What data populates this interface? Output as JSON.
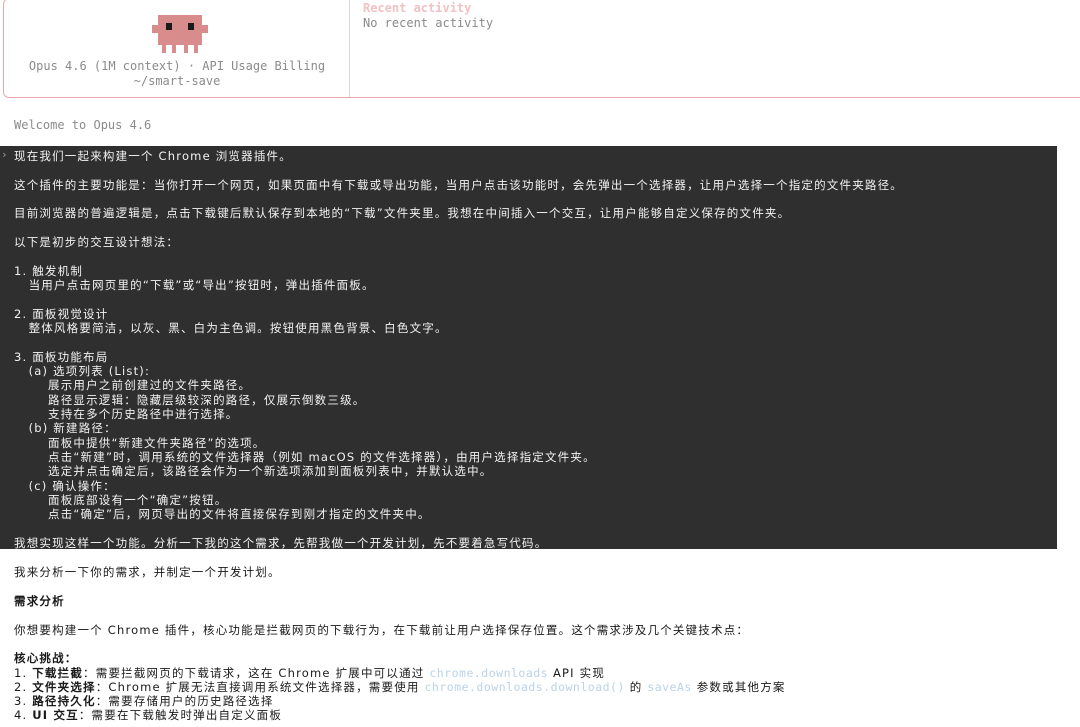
{
  "header": {
    "model_info": "Opus 4.6 (1M context) · API Usage Billing",
    "directory": "~/smart-save",
    "recent_title": "Recent activity",
    "recent_empty": "No recent activity",
    "mascot_color": "#d98c8c"
  },
  "welcome": "Welcome to Opus 4.6",
  "prompt": {
    "caret": "›",
    "lines": [
      "现在我们一起来构建一个 Chrome 浏览器插件。",
      "这个插件的主要功能是：当你打开一个网页，如果页面中有下载或导出功能，当用户点击该功能时，会先弹出一个选择器，让用户选择一个指定的文件夹路径。",
      "目前浏览器的普遍逻辑是，点击下载键后默认保存到本地的“下载”文件夹里。我想在中间插入一个交互，让用户能够自定义保存的文件夹。",
      "以下是初步的交互设计想法：",
      "1. 触发机制",
      "   当用户点击网页里的“下载”或“导出”按钮时，弹出插件面板。",
      "2. 面板视觉设计",
      "   整体风格要简洁，以灰、黑、白为主色调。按钮使用黑色背景、白色文字。",
      "3. 面板功能布局",
      "   (a) 选项列表 (List):",
      "       展示用户之前创建过的文件夹路径。",
      "       路径显示逻辑：隐藏层级较深的路径，仅展示倒数三级。",
      "       支持在多个历史路径中进行选择。",
      "   (b) 新建路径：",
      "       面板中提供“新建文件夹路径”的选项。",
      "       点击“新建”时，调用系统的文件选择器（例如 macOS 的文件选择器），由用户选择指定文件夹。",
      "       选定并点击确定后，该路径会作为一个新选项添加到面板列表中，并默认选中。",
      "   (c) 确认操作：",
      "       面板底部设有一个“确定”按钮。",
      "       点击“确定”后，网页导出的文件将直接保存到刚才指定的文件夹中。",
      "我想实现这样一个功能。分析一下我的这个需求，先帮我做一个开发计划，先不要着急写代码。"
    ]
  },
  "response": {
    "intro": "我来分析一下你的需求，并制定一个开发计划。",
    "section_title": "需求分析",
    "summary": "你想要构建一个 Chrome 插件，核心功能是拦截网页的下载行为，在下载前让用户选择保存位置。这个需求涉及几个关键技术点：",
    "challenges_title": "核心挑战：",
    "item1_num": "1. ",
    "item1_bold": "下载拦截",
    "item1_text": "：需要拦截网页的下载请求，这在 Chrome 扩展中可以通过 ",
    "item1_code": "chrome.downloads",
    "item1_tail": " API 实现",
    "item2_num": "2. ",
    "item2_bold": "文件夹选择",
    "item2_text": "：Chrome 扩展无法直接调用系统文件选择器，需要使用 ",
    "item2_code": "chrome.downloads.download()",
    "item2_mid": " 的 ",
    "item2_code2": "saveAs",
    "item2_tail": " 参数或其他方案",
    "item3_num": "3. ",
    "item3_bold": "路径持久化",
    "item3_text": "：需要存储用户的历史路径选择",
    "item4_num": "4. ",
    "item4_bold": "UI 交互",
    "item4_text": "：需要在下载触发时弹出自定义面板"
  }
}
